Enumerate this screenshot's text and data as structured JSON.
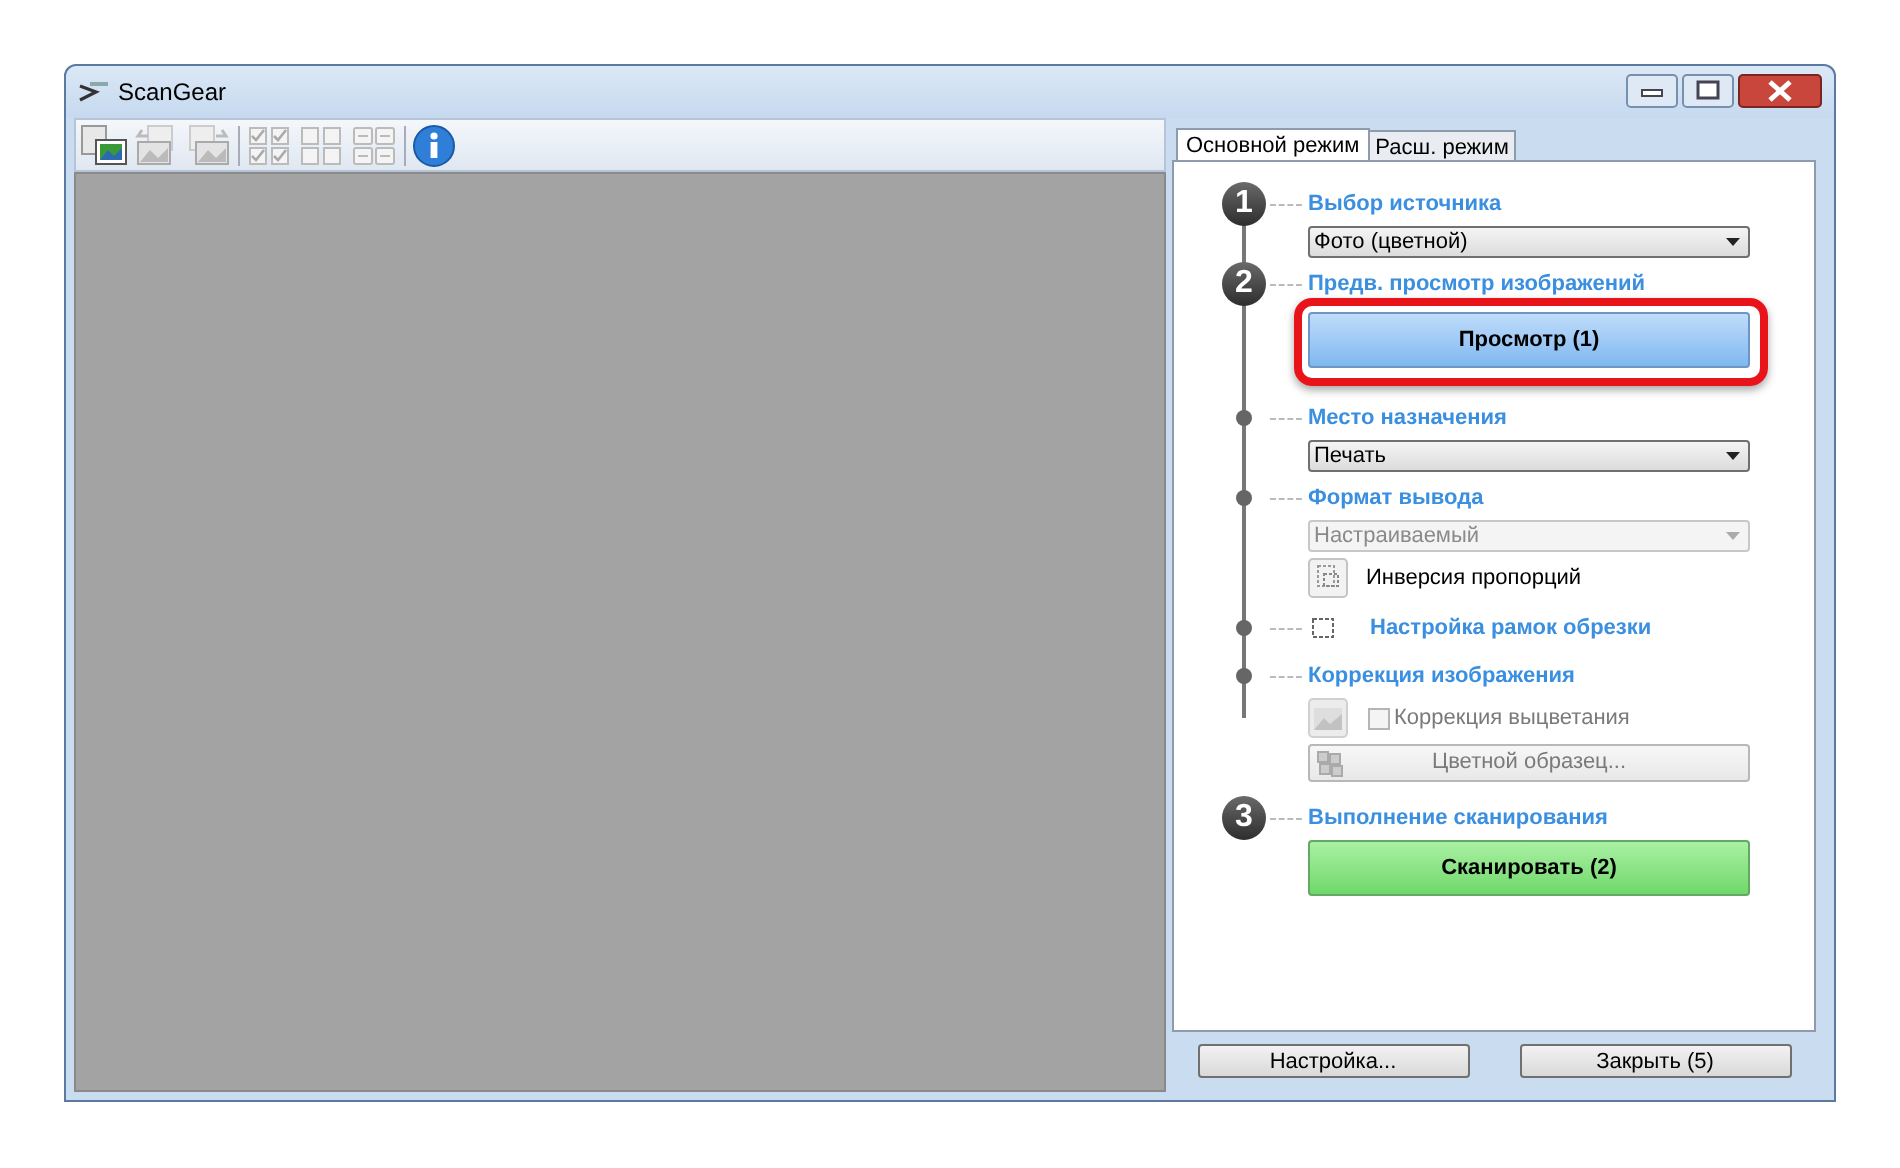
{
  "window": {
    "title": "ScanGear"
  },
  "tabs": [
    {
      "label": "Основной режим",
      "selected": true
    },
    {
      "label": "Расш. режим",
      "selected": false
    }
  ],
  "sections": [
    {
      "kind": "numbered",
      "number": "1",
      "title": "Выбор источника",
      "controls": [
        {
          "kind": "dropdown",
          "value": "Фото (цветной)",
          "disabled": false
        }
      ]
    },
    {
      "kind": "numbered",
      "number": "2",
      "title": "Предв. просмотр изображений",
      "controls": [
        {
          "kind": "preview-button",
          "label": "Просмотр (1)",
          "highlighted": true,
          "disabled": false
        }
      ]
    },
    {
      "kind": "dot",
      "title": "Место назначения",
      "controls": [
        {
          "kind": "dropdown",
          "value": "Печать",
          "disabled": false
        }
      ]
    },
    {
      "kind": "dot",
      "title": "Формат вывода",
      "controls": [
        {
          "kind": "dropdown",
          "value": "Настраиваемый",
          "disabled": true
        },
        {
          "kind": "icon-label",
          "label": "Инверсия пропорций"
        }
      ]
    },
    {
      "kind": "dot-icon",
      "title": "Настройка рамок обрезки"
    },
    {
      "kind": "dot",
      "title": "Коррекция изображения",
      "controls": [
        {
          "kind": "icon-checkbox",
          "label": "Коррекция выцветания",
          "checked": false,
          "disabled": true
        },
        {
          "kind": "icon-button",
          "label": "Цветной образец...",
          "highlighted": false,
          "disabled": true
        }
      ]
    },
    {
      "kind": "numbered",
      "number": "3",
      "title": "Выполнение сканирования",
      "controls": [
        {
          "kind": "scan-button",
          "label": "Сканировать (2)",
          "highlighted": false,
          "disabled": false
        }
      ]
    }
  ],
  "footer_buttons": [
    "Настройка...",
    "Закрыть (5)"
  ]
}
